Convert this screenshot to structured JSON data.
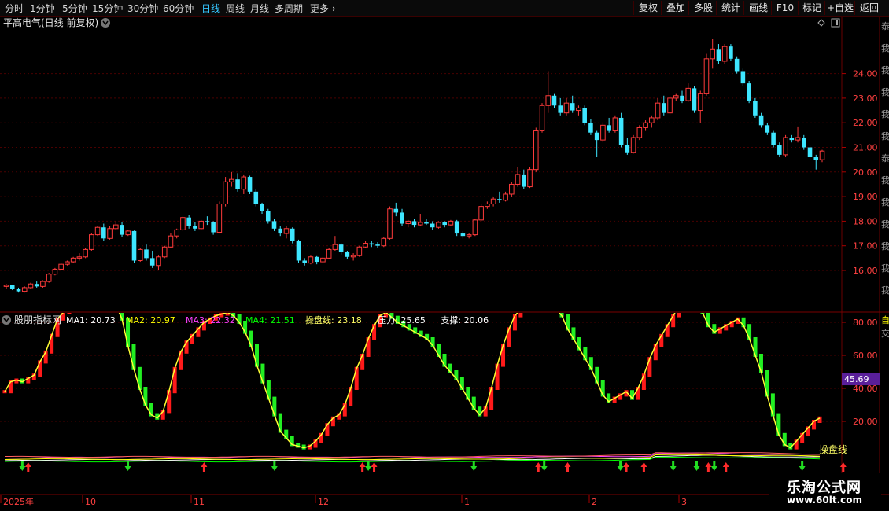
{
  "toolbar": {
    "periods": [
      "分时",
      "1分钟",
      "5分钟",
      "15分钟",
      "30分钟",
      "60分钟",
      "日线",
      "周线",
      "月线",
      "多周期",
      "更多 ›"
    ],
    "active_period": "日线",
    "right_buttons": [
      "复权",
      "叠加",
      "多股",
      "统计",
      "画线",
      "F10",
      "标记",
      "+自选",
      "返回"
    ]
  },
  "main_chart": {
    "title": "平高电气(日线 前复权)",
    "y_ticks": [
      "24.00",
      "23.00",
      "22.00",
      "21.00",
      "20.00",
      "19.00",
      "18.00",
      "17.00",
      "16.00"
    ],
    "side_text": "泰我我我我我泰我我我我我我我我我我我我我我我我我我我我我我我我我我泰我我我我我我我"
  },
  "indicator": {
    "name": "股朋指标网",
    "items": [
      {
        "label": "MA1:",
        "value": "20.73",
        "color": "#ffffff"
      },
      {
        "label": "MA2:",
        "value": "20.97",
        "color": "#ffff00"
      },
      {
        "label": "MA3:",
        "value": "22.32",
        "color": "#ff40ff"
      },
      {
        "label": "MA4:",
        "value": "21.51",
        "color": "#00ff00"
      },
      {
        "label": "操盘线:",
        "value": "23.18",
        "color": "#ffff66"
      },
      {
        "label": "压力:",
        "value": "25.65",
        "color": "#ffffff"
      },
      {
        "label": "支撑:",
        "value": "20.06",
        "color": "#ffffff"
      }
    ],
    "y_ticks": [
      "80.00",
      "60.00",
      "40.00",
      "20.00"
    ],
    "current_value": "45.69",
    "line_label": "操盘线",
    "right_label_top": "自",
    "right_label_sub": "交"
  },
  "x_axis": {
    "labels": [
      "2025年",
      "10",
      "11",
      "12",
      "1",
      "2",
      "3"
    ]
  },
  "watermark": {
    "line1": "乐淘公式网",
    "line2": "www.60lt.com"
  },
  "colors": {
    "up": "#ff3b3b",
    "down": "#3ee6ff",
    "grid": "#4a0000",
    "axis_text": "#ff4040",
    "highlight_box": "#5a1f9a"
  },
  "chart_data": {
    "type": "candlestick",
    "candles": [
      [
        15.35,
        15.45,
        15.25,
        15.4
      ],
      [
        15.4,
        15.42,
        15.2,
        15.25
      ],
      [
        15.25,
        15.3,
        15.1,
        15.15
      ],
      [
        15.15,
        15.35,
        15.1,
        15.3
      ],
      [
        15.3,
        15.5,
        15.25,
        15.45
      ],
      [
        15.45,
        15.55,
        15.3,
        15.35
      ],
      [
        15.35,
        15.6,
        15.3,
        15.55
      ],
      [
        15.55,
        15.9,
        15.5,
        15.85
      ],
      [
        15.85,
        16.1,
        15.8,
        16.05
      ],
      [
        16.05,
        16.3,
        16.0,
        16.25
      ],
      [
        16.25,
        16.4,
        16.2,
        16.35
      ],
      [
        16.35,
        16.55,
        16.3,
        16.5
      ],
      [
        16.5,
        16.7,
        16.4,
        16.55
      ],
      [
        16.55,
        16.9,
        16.5,
        16.85
      ],
      [
        16.85,
        17.5,
        16.8,
        17.45
      ],
      [
        17.45,
        17.8,
        17.4,
        17.75
      ],
      [
        17.75,
        17.9,
        17.2,
        17.3
      ],
      [
        17.3,
        17.8,
        17.25,
        17.7
      ],
      [
        17.7,
        18.0,
        17.65,
        17.85
      ],
      [
        17.85,
        17.95,
        17.35,
        17.45
      ],
      [
        17.45,
        17.65,
        17.4,
        17.6
      ],
      [
        17.6,
        17.62,
        16.3,
        16.4
      ],
      [
        16.4,
        16.9,
        16.35,
        16.85
      ],
      [
        16.85,
        17.05,
        16.4,
        16.5
      ],
      [
        16.5,
        16.8,
        16.1,
        16.2
      ],
      [
        16.2,
        16.6,
        16.0,
        16.55
      ],
      [
        16.55,
        17.0,
        16.5,
        16.95
      ],
      [
        16.95,
        17.5,
        16.9,
        17.4
      ],
      [
        17.4,
        17.7,
        17.3,
        17.65
      ],
      [
        17.65,
        18.2,
        17.6,
        18.15
      ],
      [
        18.15,
        18.25,
        17.7,
        17.8
      ],
      [
        17.8,
        17.95,
        17.6,
        17.7
      ],
      [
        17.7,
        18.05,
        17.65,
        18.0
      ],
      [
        18.0,
        18.2,
        17.85,
        17.95
      ],
      [
        17.95,
        18.0,
        17.45,
        17.55
      ],
      [
        17.55,
        18.8,
        17.5,
        18.7
      ],
      [
        18.7,
        19.8,
        18.6,
        19.6
      ],
      [
        19.6,
        20.0,
        19.4,
        19.7
      ],
      [
        19.7,
        19.95,
        19.2,
        19.3
      ],
      [
        19.3,
        19.9,
        19.1,
        19.8
      ],
      [
        19.8,
        19.85,
        19.1,
        19.2
      ],
      [
        19.2,
        19.3,
        18.6,
        18.7
      ],
      [
        18.7,
        18.75,
        18.3,
        18.4
      ],
      [
        18.4,
        18.5,
        17.9,
        18.0
      ],
      [
        18.0,
        18.1,
        17.6,
        17.7
      ],
      [
        17.7,
        17.8,
        17.4,
        17.5
      ],
      [
        17.5,
        17.8,
        17.3,
        17.7
      ],
      [
        17.7,
        17.75,
        17.1,
        17.2
      ],
      [
        17.2,
        17.25,
        16.3,
        16.4
      ],
      [
        16.4,
        16.5,
        16.2,
        16.3
      ],
      [
        16.3,
        16.6,
        16.25,
        16.55
      ],
      [
        16.55,
        16.58,
        16.25,
        16.35
      ],
      [
        16.35,
        16.55,
        16.3,
        16.5
      ],
      [
        16.5,
        16.9,
        16.45,
        16.85
      ],
      [
        16.85,
        17.4,
        16.8,
        17.05
      ],
      [
        17.05,
        17.1,
        16.65,
        16.75
      ],
      [
        16.75,
        16.8,
        16.45,
        16.55
      ],
      [
        16.55,
        16.7,
        16.4,
        16.6
      ],
      [
        16.6,
        17.0,
        16.55,
        16.95
      ],
      [
        16.95,
        17.2,
        16.9,
        17.1
      ],
      [
        17.1,
        17.2,
        16.95,
        17.05
      ],
      [
        17.05,
        17.15,
        16.9,
        17.0
      ],
      [
        17.0,
        17.35,
        16.95,
        17.3
      ],
      [
        17.3,
        18.6,
        17.25,
        18.5
      ],
      [
        18.5,
        18.75,
        18.2,
        18.35
      ],
      [
        18.35,
        18.5,
        17.8,
        17.9
      ],
      [
        17.9,
        18.05,
        17.75,
        18.0
      ],
      [
        18.0,
        18.1,
        17.75,
        17.85
      ],
      [
        17.85,
        18.3,
        17.8,
        17.95
      ],
      [
        17.95,
        18.1,
        17.85,
        17.9
      ],
      [
        17.9,
        18.0,
        17.65,
        17.75
      ],
      [
        17.75,
        18.0,
        17.7,
        17.95
      ],
      [
        17.95,
        18.0,
        17.75,
        17.85
      ],
      [
        17.85,
        18.05,
        17.8,
        18.0
      ],
      [
        18.0,
        18.05,
        17.4,
        17.5
      ],
      [
        17.5,
        17.6,
        17.3,
        17.4
      ],
      [
        17.4,
        17.5,
        17.3,
        17.45
      ],
      [
        17.45,
        18.1,
        17.4,
        18.05
      ],
      [
        18.05,
        18.7,
        18.0,
        18.6
      ],
      [
        18.6,
        18.8,
        18.5,
        18.7
      ],
      [
        18.7,
        19.0,
        18.6,
        18.9
      ],
      [
        18.9,
        19.2,
        18.75,
        18.85
      ],
      [
        18.85,
        19.2,
        18.8,
        19.1
      ],
      [
        19.1,
        19.6,
        19.0,
        19.5
      ],
      [
        19.5,
        20.2,
        19.4,
        19.9
      ],
      [
        19.9,
        20.1,
        19.3,
        19.4
      ],
      [
        19.4,
        20.2,
        19.35,
        20.1
      ],
      [
        20.1,
        21.8,
        20.0,
        21.7
      ],
      [
        21.7,
        22.8,
        21.6,
        22.7
      ],
      [
        22.7,
        24.1,
        22.4,
        23.1
      ],
      [
        23.1,
        23.2,
        22.6,
        22.7
      ],
      [
        22.7,
        23.0,
        22.3,
        22.4
      ],
      [
        22.4,
        23.0,
        22.3,
        22.8
      ],
      [
        22.8,
        23.1,
        22.4,
        22.5
      ],
      [
        22.5,
        22.7,
        22.3,
        22.6
      ],
      [
        22.6,
        22.7,
        21.9,
        22.0
      ],
      [
        22.0,
        22.15,
        21.5,
        21.6
      ],
      [
        21.6,
        21.7,
        20.6,
        21.3
      ],
      [
        21.3,
        22.0,
        21.2,
        21.9
      ],
      [
        21.9,
        22.2,
        21.6,
        21.7
      ],
      [
        21.7,
        22.3,
        21.6,
        22.2
      ],
      [
        22.2,
        22.4,
        21.0,
        21.1
      ],
      [
        21.1,
        21.4,
        20.7,
        20.8
      ],
      [
        20.8,
        21.5,
        20.75,
        21.4
      ],
      [
        21.4,
        21.9,
        21.3,
        21.8
      ],
      [
        21.8,
        22.1,
        21.7,
        22.0
      ],
      [
        22.0,
        22.3,
        21.8,
        22.2
      ],
      [
        22.2,
        23.0,
        22.1,
        22.8
      ],
      [
        22.8,
        23.1,
        22.3,
        22.4
      ],
      [
        22.4,
        23.1,
        22.3,
        23.0
      ],
      [
        23.0,
        23.2,
        22.9,
        23.1
      ],
      [
        23.1,
        23.3,
        22.8,
        22.9
      ],
      [
        22.9,
        23.6,
        22.85,
        23.4
      ],
      [
        23.4,
        23.5,
        22.4,
        22.5
      ],
      [
        22.5,
        23.3,
        22.0,
        23.2
      ],
      [
        23.2,
        24.8,
        23.1,
        24.6
      ],
      [
        24.6,
        25.4,
        24.2,
        25.0
      ],
      [
        25.0,
        25.2,
        24.4,
        24.5
      ],
      [
        24.5,
        25.2,
        24.4,
        25.1
      ],
      [
        25.1,
        25.2,
        24.5,
        24.6
      ],
      [
        24.6,
        24.7,
        24.0,
        24.1
      ],
      [
        24.1,
        24.2,
        23.5,
        23.6
      ],
      [
        23.6,
        23.7,
        22.8,
        22.9
      ],
      [
        22.9,
        23.0,
        22.2,
        22.3
      ],
      [
        22.3,
        22.4,
        21.8,
        21.9
      ],
      [
        21.9,
        22.0,
        21.5,
        21.6
      ],
      [
        21.6,
        21.7,
        21.0,
        21.1
      ],
      [
        21.1,
        21.2,
        20.6,
        20.7
      ],
      [
        20.7,
        21.5,
        20.6,
        21.4
      ],
      [
        21.4,
        21.5,
        21.2,
        21.3
      ],
      [
        21.3,
        21.85,
        21.2,
        21.4
      ],
      [
        21.4,
        21.5,
        20.9,
        21.0
      ],
      [
        21.0,
        21.1,
        20.5,
        20.6
      ],
      [
        20.6,
        20.7,
        20.1,
        20.5
      ],
      [
        20.5,
        20.9,
        20.4,
        20.85
      ]
    ],
    "oscillator": [
      38,
      44,
      45,
      44,
      46,
      48,
      56,
      62,
      72,
      82,
      86,
      88,
      90,
      92,
      94,
      96,
      97,
      96,
      94,
      90,
      82,
      66,
      52,
      40,
      30,
      24,
      22,
      26,
      38,
      52,
      62,
      68,
      72,
      76,
      80,
      82,
      84,
      85,
      86,
      84,
      80,
      74,
      66,
      54,
      44,
      34,
      24,
      14,
      10,
      6,
      5,
      4,
      5,
      8,
      12,
      18,
      22,
      24,
      30,
      40,
      52,
      60,
      70,
      78,
      84,
      86,
      83,
      80,
      78,
      76,
      74,
      72,
      70,
      66,
      60,
      54,
      50,
      46,
      40,
      34,
      28,
      24,
      28,
      40,
      54,
      66,
      76,
      84,
      88,
      90,
      89,
      88,
      90,
      90,
      88,
      84,
      76,
      70,
      64,
      58,
      52,
      44,
      36,
      32,
      34,
      36,
      38,
      34,
      40,
      48,
      58,
      66,
      72,
      78,
      84,
      90,
      92,
      94,
      90,
      86,
      78,
      74,
      76,
      78,
      80,
      82,
      78,
      70,
      60,
      50,
      36,
      24,
      12,
      6,
      4,
      8,
      12,
      16,
      20,
      22
    ]
  }
}
